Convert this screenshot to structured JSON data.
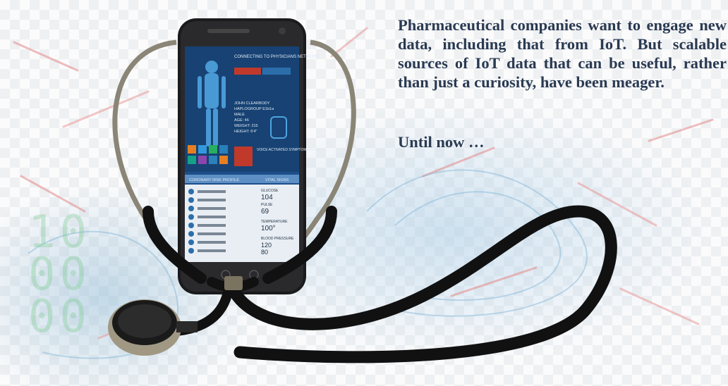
{
  "slide": {
    "paragraph": "Pharmaceutical companies want to engage new data, including that from IoT. But scalable sources of IoT data that can be useful, rather than just a curiosity, have been meager.",
    "closing": "Until now …"
  },
  "phone": {
    "screen_heading": "CONNECTING TO PHYSICIANS NETWORK",
    "patient_lines": [
      "JOHN CLEARBODY",
      "HAPLOGROUP E1b1a",
      "MALE",
      "AGE: 46",
      "WEIGHT: 215",
      "HEIGHT: 6'4\""
    ],
    "voice_label": "VOICE ACTIVATED SYMPTOM READER",
    "tab_left": "CORONARY RISK PROFILE",
    "tab_right": "VITAL SIGNS",
    "glucose_label": "GLUCOSE",
    "glucose_value": "104",
    "pulse_label": "PULSE",
    "pulse_value": "69",
    "temp_label": "TEMPERATURE",
    "temp_value": "100°",
    "bp_label": "BLOOD PRESSURE",
    "bp_value_top": "120",
    "bp_value_bottom": "80"
  },
  "colors": {
    "text": "#2a3a52",
    "screen": "#1d4f8a",
    "stethoscope": "#111111"
  }
}
